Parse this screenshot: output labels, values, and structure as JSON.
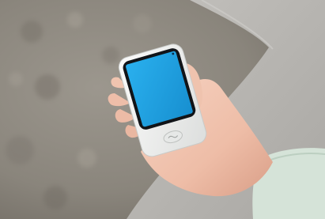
{
  "scene": {
    "subject": "hand-held-translator-device",
    "device": {
      "body_color": "#f2f3f1",
      "screen_color": "#1fa3e3",
      "screen_lines_primary": [
        "",
        ""
      ],
      "screen_lines_secondary": [
        "",
        "",
        ""
      ]
    },
    "background": {
      "ground_color": "#8f8b82",
      "path_color": "#b6b4b1",
      "skin_color": "#f1c7b3",
      "sleeve_color": "#d6e4da"
    }
  }
}
